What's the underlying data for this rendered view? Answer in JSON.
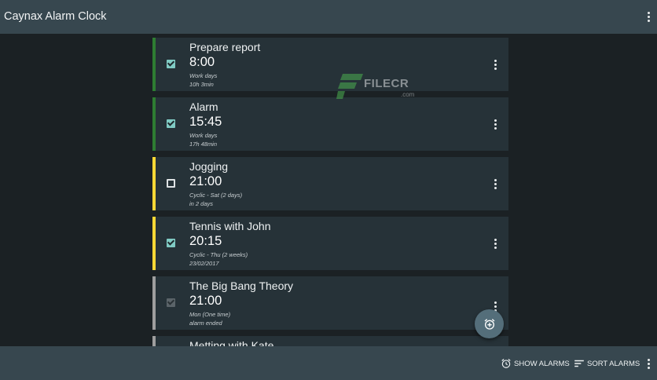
{
  "app": {
    "title": "Caynax Alarm Clock"
  },
  "alarms": [
    {
      "title": "Prepare report",
      "time": "8:00",
      "line1": "Work days",
      "line2": "10h 3min",
      "stripe": "#2e7d32",
      "state": "on"
    },
    {
      "title": "Alarm",
      "time": "15:45",
      "line1": "Work days",
      "line2": "17h 48min",
      "stripe": "#2e7d32",
      "state": "on"
    },
    {
      "title": "Jogging",
      "time": "21:00",
      "line1": "Cyclic - Sat (2 days)",
      "line2": "in 2 days",
      "stripe": "#fdd835",
      "state": "off"
    },
    {
      "title": "Tennis with John",
      "time": "20:15",
      "line1": "Cyclic - Thu (2 weeks)",
      "line2": "23/02/2017",
      "stripe": "#fdd835",
      "state": "on"
    },
    {
      "title": "The Big Bang Theory",
      "time": "21:00",
      "line1": "Mon (One time)",
      "line2": "alarm ended",
      "stripe": "#9e9e9e",
      "state": "dim"
    },
    {
      "title": "Metting with Kate",
      "time": "",
      "line1": "",
      "line2": "",
      "stripe": "#9e9e9e",
      "state": "off"
    }
  ],
  "watermark": {
    "text": "FILECR",
    "sub": ".com"
  },
  "bottombar": {
    "show_alarms": "SHOW ALARMS",
    "sort_alarms": "SORT ALARMS"
  },
  "icons": {
    "overflow": "more-vert-icon",
    "fab": "add-alarm-icon",
    "show_alarms": "alarm-clock-icon",
    "sort_alarms": "sort-icon"
  },
  "colors": {
    "topbar": "#37474f",
    "background": "#1b2124",
    "card": "#263238",
    "checkbox_on": "#80cbc4",
    "fab": "#546e7a"
  }
}
